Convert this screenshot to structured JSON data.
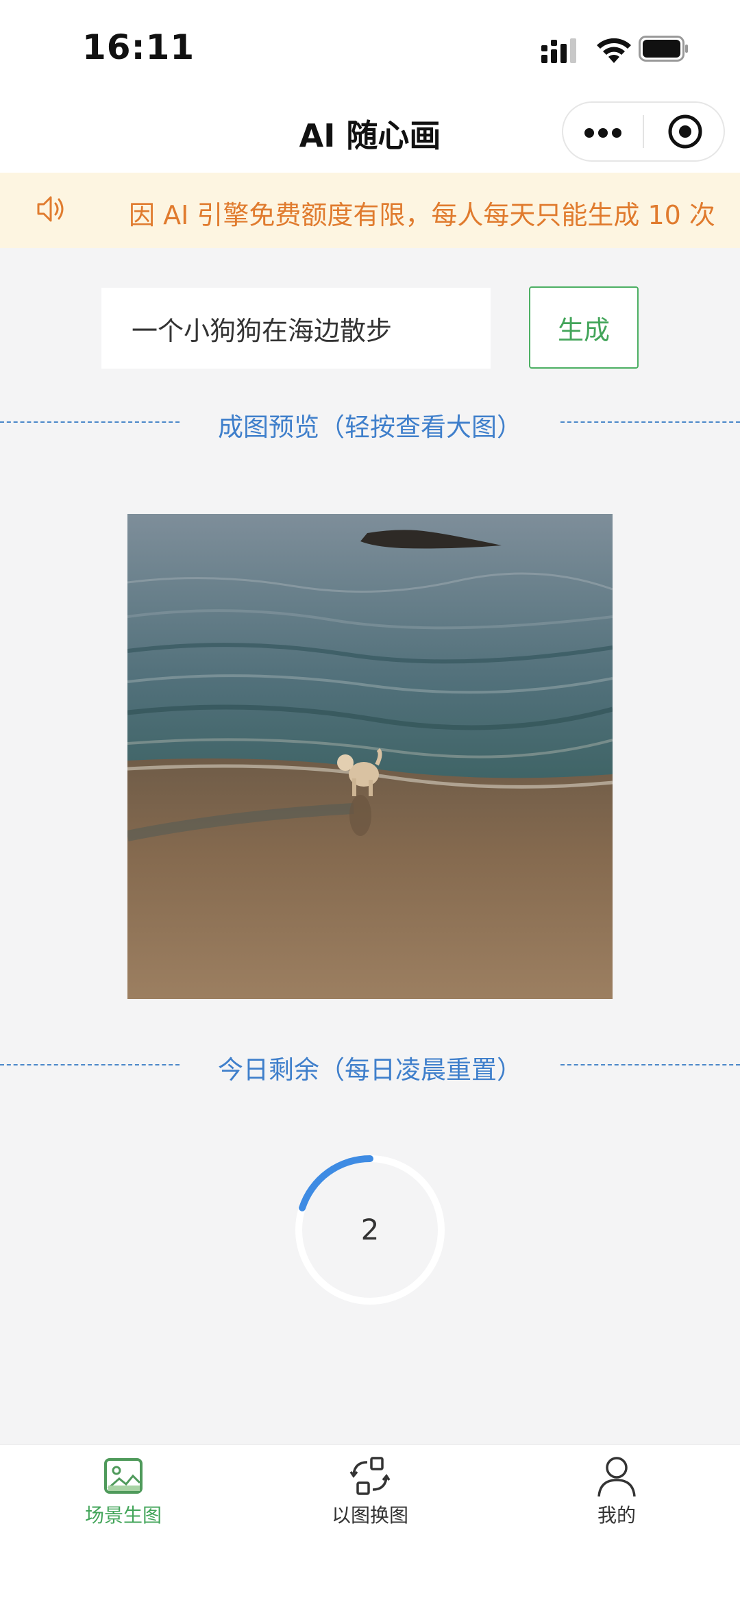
{
  "status_bar": {
    "time": "16:11"
  },
  "header": {
    "title": "AI 随心画"
  },
  "notice": {
    "text": "因 AI 引擎免费额度有限，每人每天只能生成 10 次"
  },
  "prompt": {
    "value": "一个小狗狗在海边散步",
    "placeholder": ""
  },
  "generate_button": {
    "label": "生成"
  },
  "preview_section": {
    "label": "成图预览（轻按查看大图）"
  },
  "remaining_section": {
    "label": "今日剩余（每日凌晨重置）",
    "count": "2",
    "progress_fraction": 0.2
  },
  "tabs": [
    {
      "label": "场景生图",
      "icon": "image-icon",
      "active": true
    },
    {
      "label": "以图换图",
      "icon": "swap-icon",
      "active": false
    },
    {
      "label": "我的",
      "icon": "user-icon",
      "active": false
    }
  ],
  "colors": {
    "accent_green": "#43a55a",
    "accent_blue": "#3f7fcb",
    "notice_orange": "#e07b2e",
    "notice_bg": "#fdf5e1"
  }
}
